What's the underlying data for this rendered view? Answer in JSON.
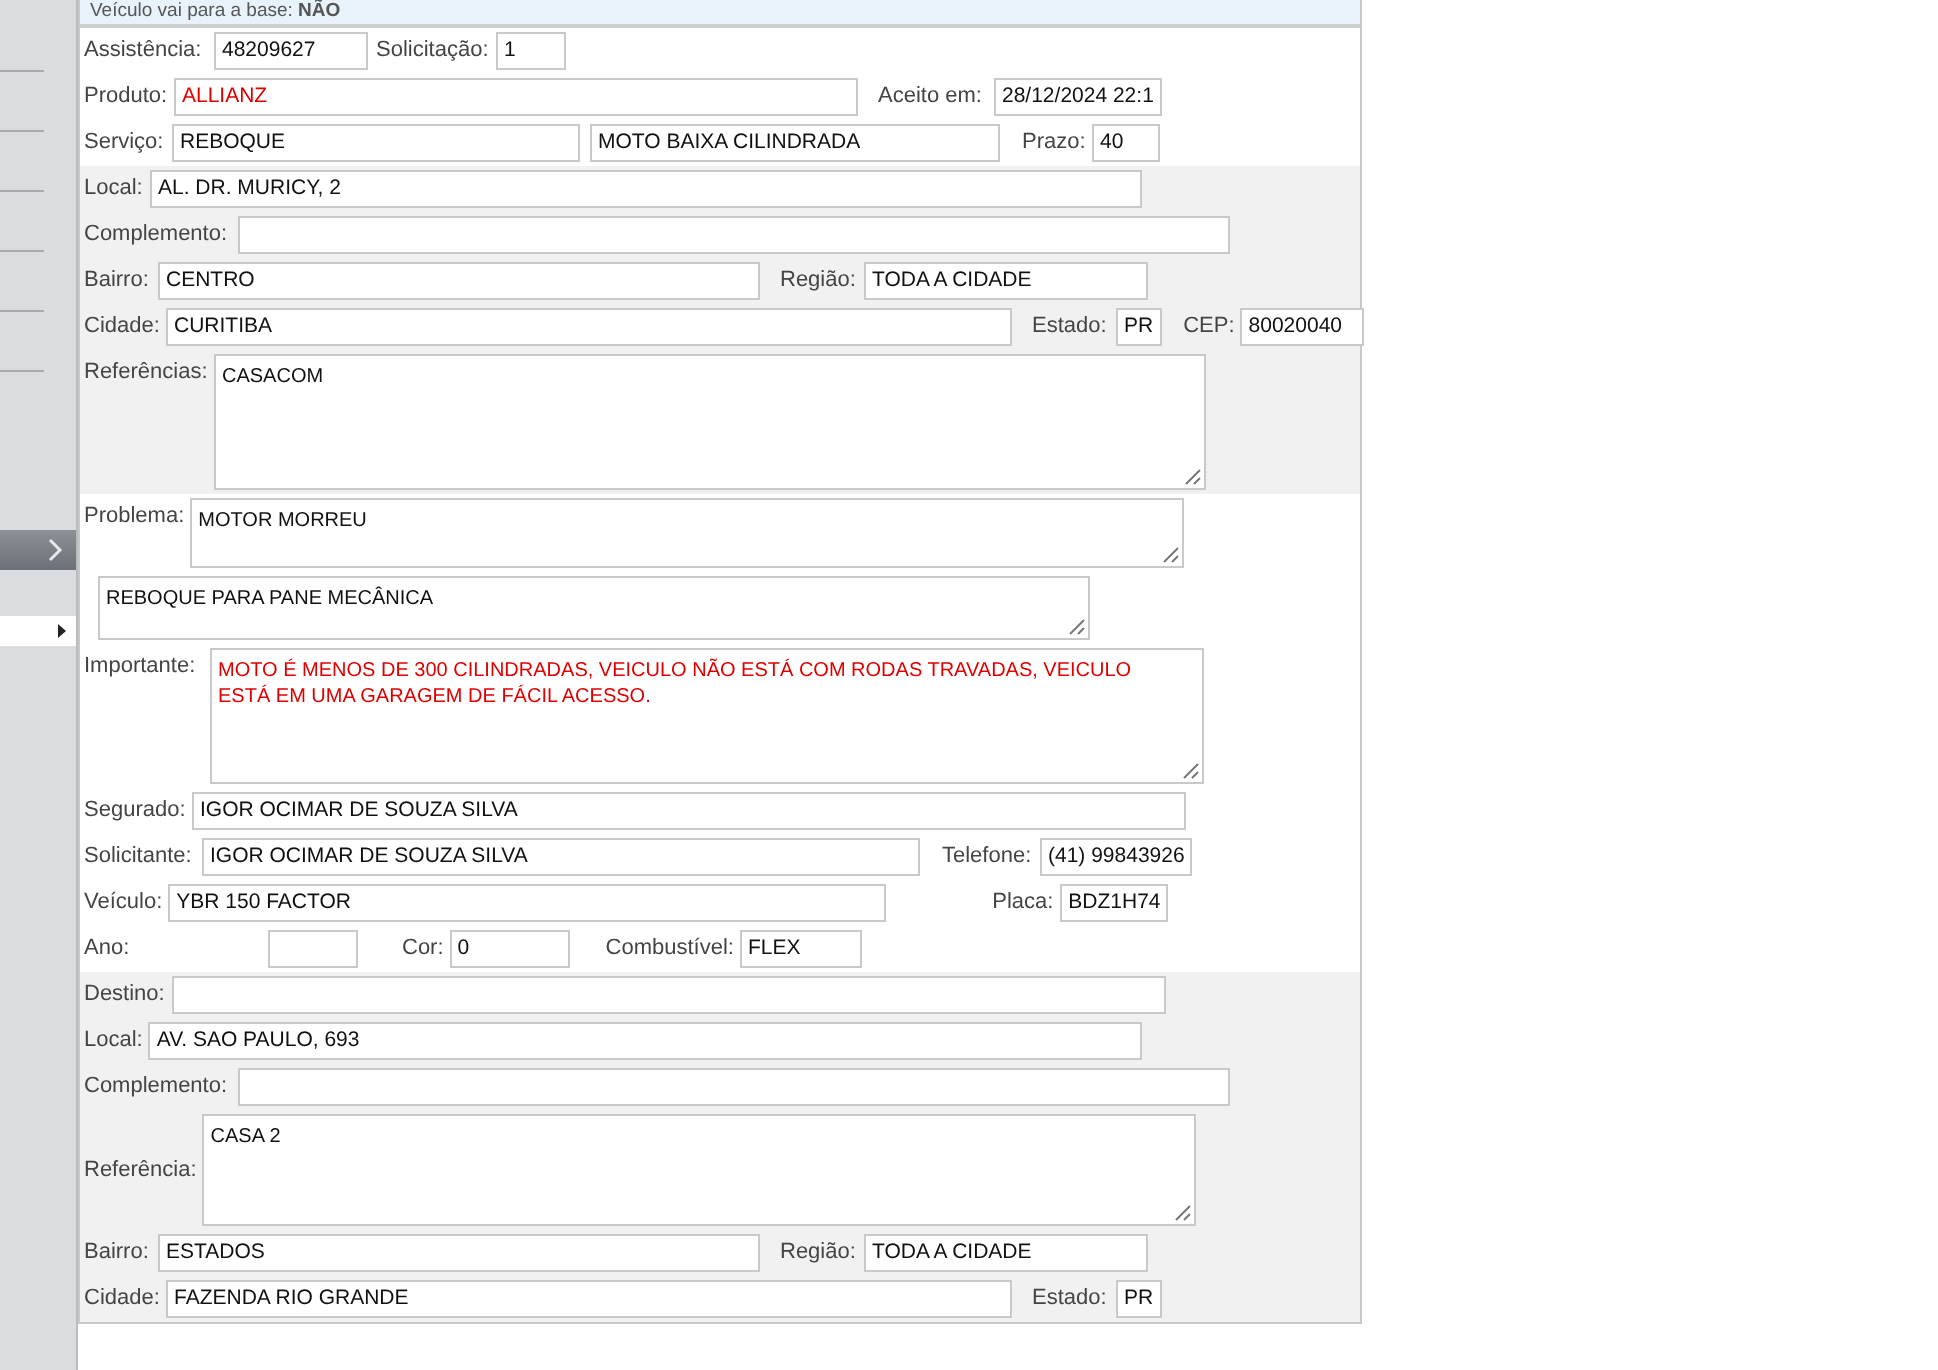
{
  "notice": "Veículo vai para a base: **NÃO**",
  "sections": [
    {
      "shaded": false,
      "rows": [
        {
          "fields": [
            {
              "label": "Assistência:",
              "value": "48209627",
              "kind": "input",
              "alert": false
            },
            {
              "label": "Solicitação:",
              "value": "1",
              "kind": "input",
              "alert": false
            }
          ]
        },
        {
          "fields": [
            {
              "label": "Produto:",
              "value": "ALLIANZ",
              "kind": "input",
              "alert": true
            },
            {
              "label": "Aceito em:",
              "value": "28/12/2024 22:1",
              "kind": "input",
              "alert": false
            }
          ]
        },
        {
          "fields": [
            {
              "label": "Serviço:",
              "value": "REBOQUE",
              "kind": "input",
              "alert": false
            },
            {
              "value": "MOTO BAIXA CILINDRADA",
              "kind": "input",
              "alert": false
            },
            {
              "label": "Prazo:",
              "value": "40",
              "kind": "input",
              "alert": false
            }
          ]
        }
      ]
    },
    {
      "shaded": true,
      "rows": [
        {
          "fields": [
            {
              "label": "Local:",
              "value": "AL. DR. MURICY, 2",
              "kind": "input",
              "alert": false
            }
          ]
        },
        {
          "fields": [
            {
              "label": "Complemento:",
              "kind": "input"
            }
          ]
        },
        {
          "fields": [
            {
              "label": "Bairro:",
              "value": "CENTRO",
              "kind": "input",
              "alert": false
            },
            {
              "label": "Região:",
              "value": "TODA A CIDADE",
              "kind": "input",
              "alert": false
            }
          ]
        },
        {
          "fields": [
            {
              "label": "Cidade:",
              "value": "CURITIBA",
              "kind": "input",
              "alert": false
            },
            {
              "label": "Estado:",
              "value": "PR",
              "kind": "input",
              "alert": false
            },
            {
              "label": "CEP:",
              "value": "80020040",
              "kind": "input",
              "alert": false
            }
          ]
        },
        {
          "fields": [
            {
              "label": "Referências:",
              "value": "CASACOM",
              "kind": "textarea",
              "alert": false
            }
          ]
        }
      ]
    },
    {
      "shaded": false,
      "rows": [
        {
          "fields": [
            {
              "label": "Problema:",
              "value": "MOTOR MORREU",
              "kind": "textarea",
              "alert": false
            }
          ]
        },
        {
          "fields": [
            {
              "value": "REBOQUE PARA PANE MECÂNICA",
              "kind": "textarea",
              "alert": false
            }
          ]
        },
        {
          "fields": [
            {
              "label": "Importante:",
              "value": "MOTO É MENOS DE 300 CILINDRADAS, VEICULO NÃO ESTÁ COM RODAS TRAVADAS, VEICULO ESTÁ EM UMA GARAGEM DE FÁCIL ACESSO.",
              "kind": "textarea",
              "alert": true
            }
          ]
        },
        {
          "fields": [
            {
              "label": "Segurado:",
              "value": "IGOR OCIMAR DE SOUZA SILVA",
              "kind": "input",
              "alert": false
            }
          ]
        },
        {
          "fields": [
            {
              "label": "Solicitante:",
              "value": "IGOR OCIMAR DE SOUZA SILVA",
              "kind": "input",
              "alert": false
            },
            {
              "label": "Telefone:",
              "value": "(41) 99843926",
              "kind": "input",
              "alert": false
            }
          ]
        },
        {
          "fields": [
            {
              "label": "Veículo:",
              "value": "YBR 150 FACTOR",
              "kind": "input",
              "alert": false
            },
            {
              "label": "Placa:",
              "value": "BDZ1H74",
              "kind": "input",
              "alert": false
            }
          ]
        },
        {
          "fields": [
            {
              "label": "Ano:",
              "kind": "input"
            },
            {
              "label": "Cor:",
              "value": "0",
              "kind": "input",
              "alert": false
            },
            {
              "label": "Combustível:",
              "value": "FLEX",
              "kind": "input",
              "alert": false
            }
          ]
        }
      ]
    },
    {
      "shaded": true,
      "rows": [
        {
          "fields": [
            {
              "label": "Destino:",
              "kind": "input"
            }
          ]
        },
        {
          "fields": [
            {
              "label": "Local:",
              "value": "AV. SAO PAULO, 693",
              "kind": "input",
              "alert": false
            }
          ]
        },
        {
          "fields": [
            {
              "label": "Complemento:",
              "kind": "input"
            }
          ]
        },
        {
          "fields": [
            {
              "label": "Referência:",
              "value": "CASA 2",
              "kind": "textarea",
              "alert": false
            }
          ]
        },
        {
          "fields": [
            {
              "label": "Bairro:",
              "value": "ESTADOS",
              "kind": "input",
              "alert": false
            },
            {
              "label": "Região:",
              "value": "TODA A CIDADE",
              "kind": "input",
              "alert": false
            }
          ]
        },
        {
          "fields": [
            {
              "label": "Cidade:",
              "value": "FAZENDA RIO GRANDE",
              "kind": "input",
              "alert": false
            },
            {
              "label": "Estado:",
              "value": "PR",
              "kind": "input",
              "alert": false
            }
          ]
        }
      ]
    }
  ]
}
